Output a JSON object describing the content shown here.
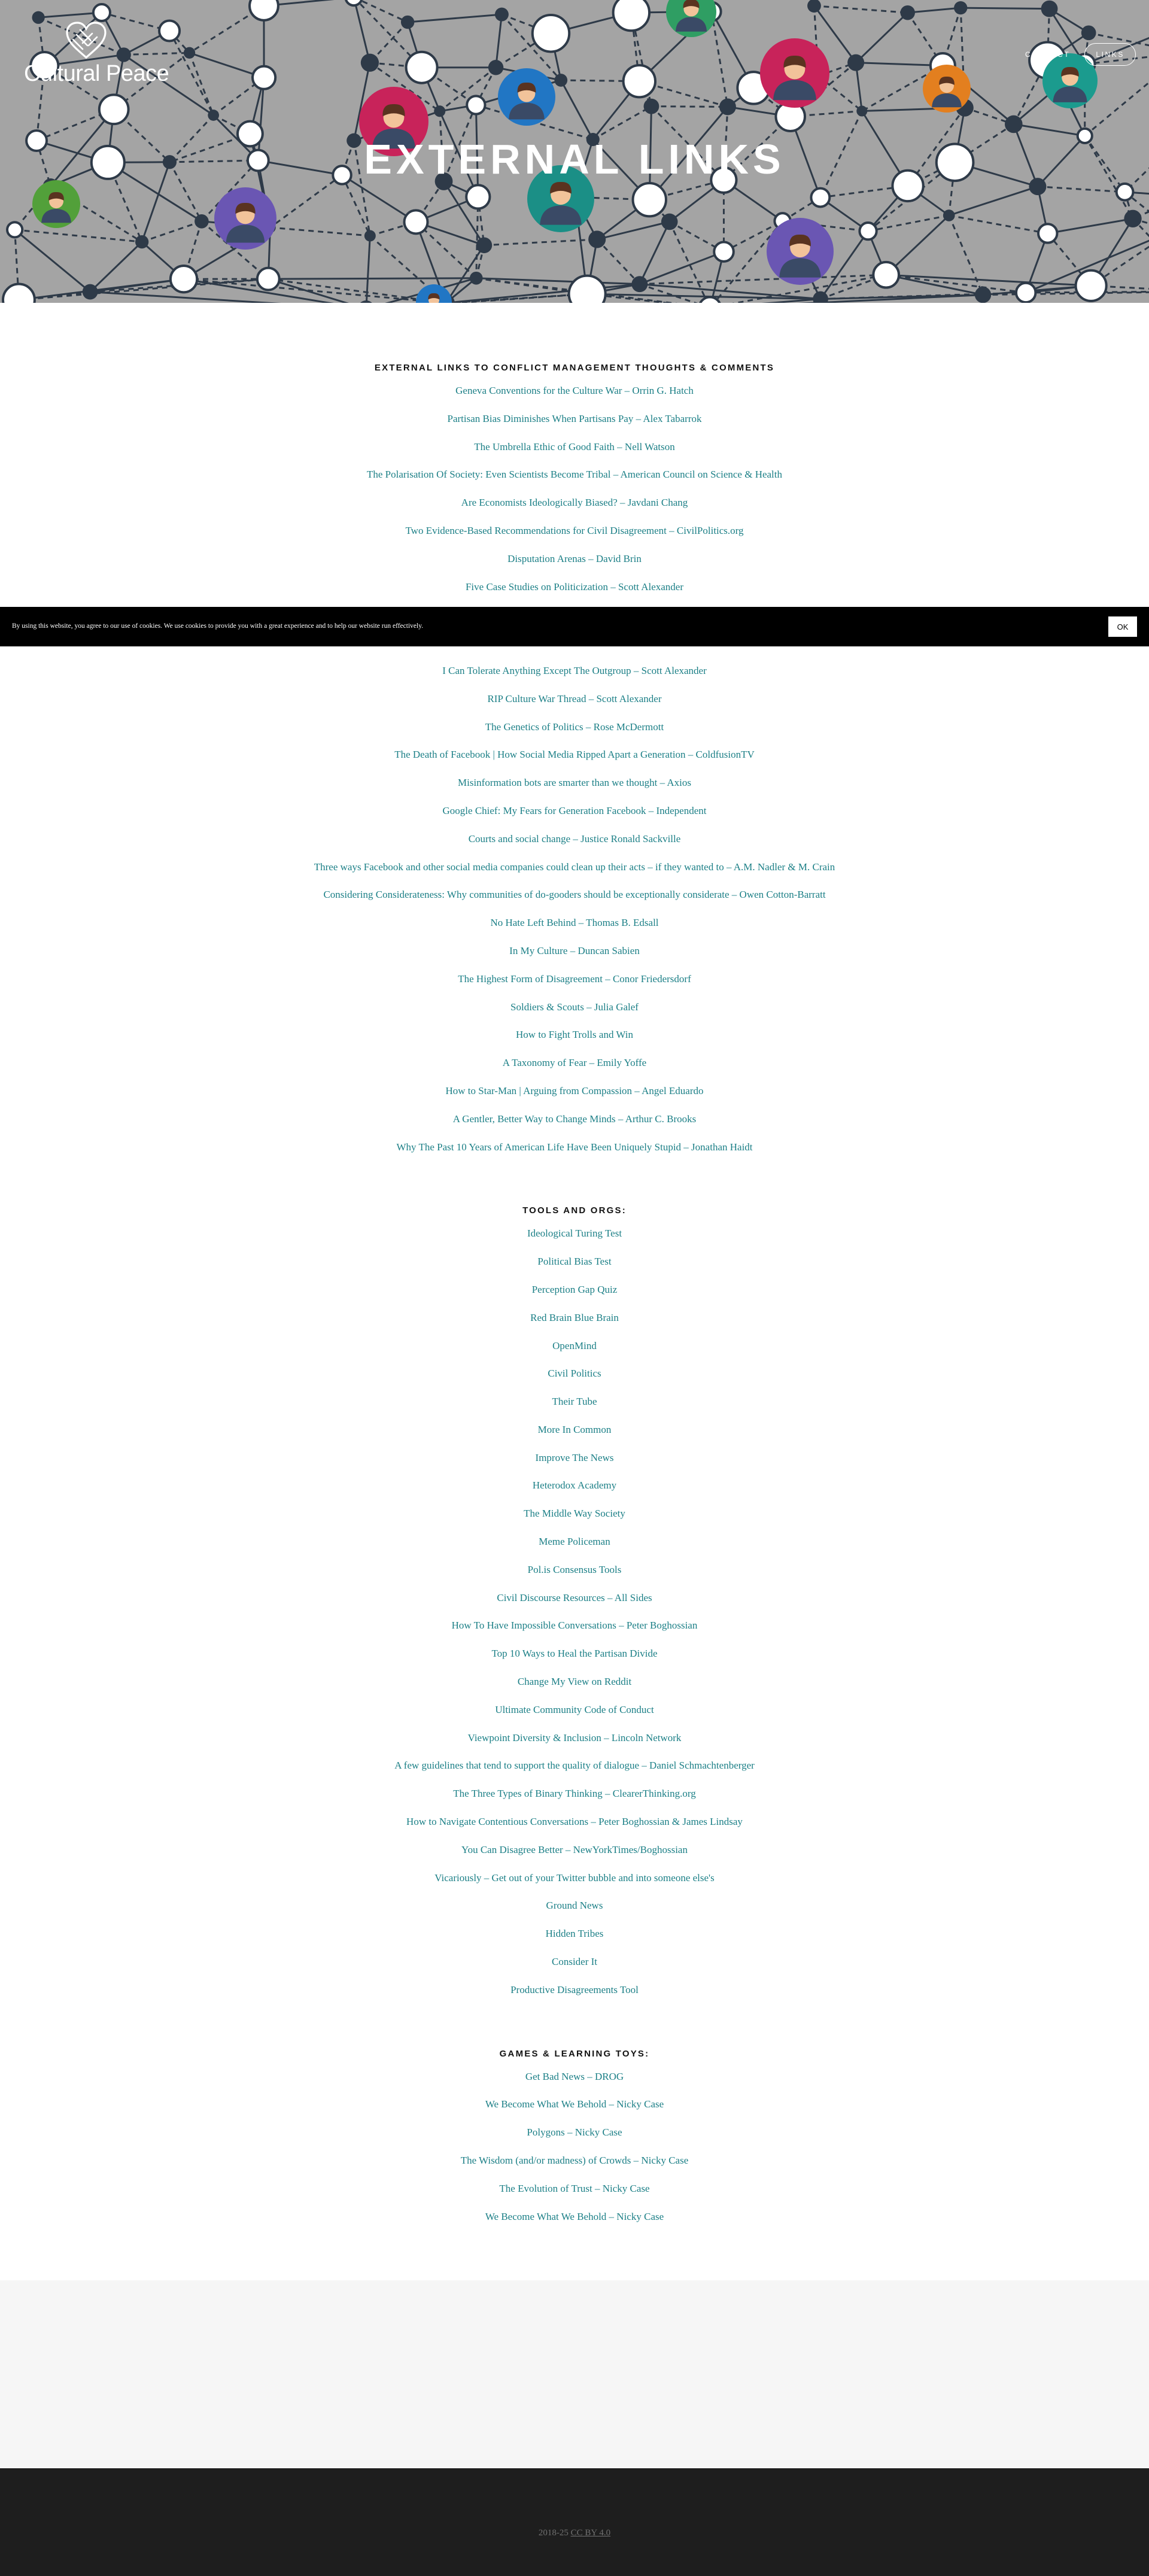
{
  "site": {
    "logo_text": "Cultural Peace",
    "nav": [
      {
        "label": "CONTACT",
        "active": false
      },
      {
        "label": "LINKS",
        "active": true
      }
    ]
  },
  "hero": {
    "title": "EXTERNAL LINKS"
  },
  "sections": [
    {
      "heading": "EXTERNAL LINKS TO CONFLICT MANAGEMENT THOUGHTS & COMMENTS",
      "links": [
        "Geneva Conventions for the Culture War – Orrin G. Hatch",
        "Partisan Bias Diminishes When Partisans Pay – Alex Tabarrok",
        "The Umbrella Ethic of Good Faith – Nell Watson",
        "The Polarisation Of Society: Even Scientists Become Tribal – American Council on Science & Health",
        "Are Economists Ideologically Biased? – Javdani Chang",
        "Two Evidence-Based Recommendations for Civil Disagreement – CivilPolitics.org",
        "Disputation Arenas – David Brin",
        "Five Case Studies on Politicization – Scott Alexander",
        "",
        "",
        "I Can Tolerate Anything Except The Outgroup – Scott Alexander",
        "RIP Culture War Thread – Scott Alexander",
        "The Genetics of Politics – Rose McDermott",
        "The Death of Facebook | How Social Media Ripped Apart a Generation – ColdfusionTV",
        "Misinformation bots are smarter than we thought – Axios",
        "Google Chief: My Fears for Generation Facebook – Independent",
        "Courts and social change – Justice Ronald Sackville",
        "Three ways Facebook and other social media companies could clean up their acts – if they wanted to – A.M. Nadler & M. Crain",
        "Considering Considerateness: Why communities of do-gooders should be exceptionally considerate – Owen Cotton-Barratt",
        "No Hate Left Behind – Thomas B. Edsall",
        "In My Culture – Duncan Sabien",
        "The Highest Form of Disagreement – Conor Friedersdorf",
        "Soldiers & Scouts – Julia Galef",
        "How to Fight Trolls and Win",
        "A Taxonomy of Fear – Emily Yoffe",
        "How to Star-Man | Arguing from Compassion – Angel Eduardo",
        "A Gentler, Better Way to Change Minds – Arthur C. Brooks",
        "Why The Past 10 Years of American Life Have Been Uniquely Stupid – Jonathan Haidt"
      ]
    },
    {
      "heading": "TOOLS AND ORGS:",
      "links": [
        "Ideological Turing Test",
        "Political Bias Test",
        "Perception Gap Quiz",
        "Red Brain Blue Brain",
        "OpenMind",
        "Civil Politics",
        "Their Tube",
        "More In Common",
        "Improve The News",
        "Heterodox Academy",
        "The Middle Way Society",
        "Meme Policeman",
        "Pol.is Consensus Tools",
        "Civil Discourse Resources – All Sides",
        "How To Have Impossible Conversations – Peter Boghossian",
        "Top 10 Ways to Heal the Partisan Divide",
        "Change My View on Reddit",
        "Ultimate Community Code of Conduct",
        "Viewpoint Diversity & Inclusion – Lincoln Network",
        "A few guidelines that tend to support the quality of dialogue – Daniel Schmachtenberger",
        "The Three Types of Binary Thinking – ClearerThinking.org",
        "How to Navigate Contentious Conversations – Peter Boghossian & James Lindsay",
        "You Can Disagree Better – NewYorkTimes/Boghossian",
        "Vicariously – Get out of your Twitter bubble and into someone else's",
        "Ground News",
        "Hidden Tribes",
        "Consider It",
        "Productive Disagreements Tool"
      ]
    },
    {
      "heading": "GAMES & LEARNING TOYS:",
      "links": [
        "Get Bad News – DROG",
        "We Become What We Behold – Nicky Case",
        "Polygons – Nicky Case",
        "The Wisdom (and/or madness) of Crowds – Nicky Case",
        "The Evolution of Trust – Nicky Case",
        "We Become What We Behold – Nicky Case"
      ]
    }
  ],
  "cookie": {
    "text": "By using this website, you agree to our use of cookies. We use cookies to provide you with a great experience and to help our website run effectively.",
    "button": "OK"
  },
  "footer": {
    "years": "2018-25",
    "license": "CC BY 4.0"
  },
  "colors": {
    "hero_bg": "#a4a4a4",
    "network_line": "#2e3a48",
    "link": "#1b7f86",
    "cookie_bg": "#000000",
    "footer_bg": "#1e1e1e"
  },
  "icons": [
    "heart-hands-logo-icon",
    "person-avatar-icon"
  ]
}
